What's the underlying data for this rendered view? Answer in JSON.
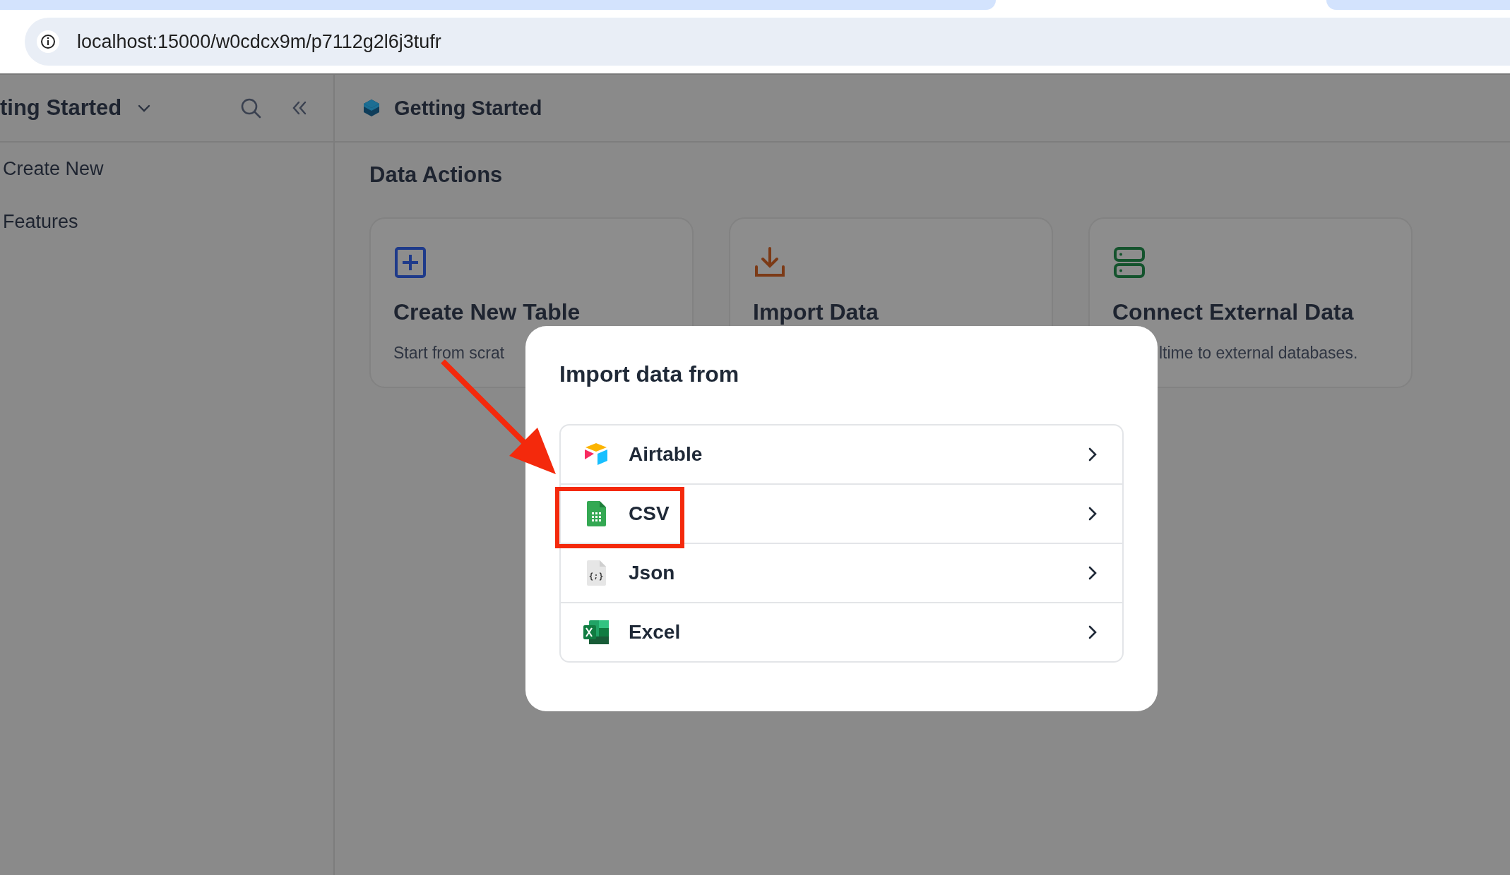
{
  "browser": {
    "address": "localhost:15000/w0cdcx9m/p7112g2l6j3tufr"
  },
  "sidebar": {
    "title": "ting Started",
    "items": [
      {
        "label": "Create New"
      },
      {
        "label": "Features"
      }
    ]
  },
  "main": {
    "title": "Getting Started",
    "section": "Data Actions",
    "cards": [
      {
        "kind": "create",
        "title": "Create New Table",
        "description": "Start from scrat"
      },
      {
        "kind": "import",
        "title": "Import Data"
      },
      {
        "kind": "connect",
        "title": "Connect External Data",
        "description": "ltime to external databases."
      }
    ]
  },
  "dialog": {
    "title": "Import data from",
    "options": [
      {
        "kind": "airtable",
        "label": "Airtable",
        "highlighted": false
      },
      {
        "kind": "csv",
        "label": "CSV",
        "highlighted": true
      },
      {
        "kind": "json",
        "label": "Json",
        "highlighted": false
      },
      {
        "kind": "excel",
        "label": "Excel",
        "highlighted": false
      }
    ]
  }
}
